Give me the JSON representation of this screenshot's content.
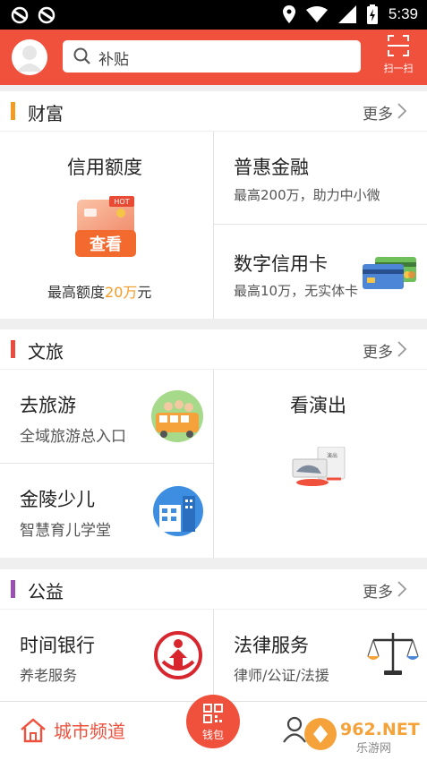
{
  "status_bar": {
    "time": "5:39"
  },
  "header": {
    "search_placeholder": "补贴",
    "scan_label": "扫一扫"
  },
  "sections": {
    "wealth": {
      "title": "财富",
      "more": "更多",
      "accent": "#f59a23"
    },
    "culture_travel": {
      "title": "文旅",
      "more": "更多",
      "accent": "#ea4b3c"
    },
    "charity": {
      "title": "公益",
      "more": "更多",
      "accent": "#9b4fb5"
    }
  },
  "wealth": {
    "credit_limit": {
      "title": "信用额度",
      "badge": "HOT",
      "button": "查看",
      "sub_prefix": "最高额度",
      "sub_amount": "20万",
      "sub_suffix": "元"
    },
    "inclusive_finance": {
      "title": "普惠金融",
      "sub": "最高200万，助力中小微"
    },
    "digital_card": {
      "title": "数字信用卡",
      "sub": "最高10万，无实体卡"
    }
  },
  "culture_travel": {
    "travel": {
      "title": "去旅游",
      "sub": "全域旅游总入口"
    },
    "performance": {
      "title": "看演出",
      "ticket_text": "演出"
    },
    "kids": {
      "title": "金陵少儿",
      "sub": "智慧育儿学堂"
    }
  },
  "charity": {
    "time_bank": {
      "title": "时间银行",
      "sub": "养老服务"
    },
    "legal": {
      "title": "法律服务",
      "sub": "律师/公证/法援"
    }
  },
  "bottom_nav": {
    "city_channel": "城市频道",
    "wallet": "钱包"
  },
  "watermark": {
    "text": "962.NET",
    "sub": "乐游网"
  },
  "colors": {
    "brand": "#f0513d",
    "amount": "#f59a23"
  }
}
